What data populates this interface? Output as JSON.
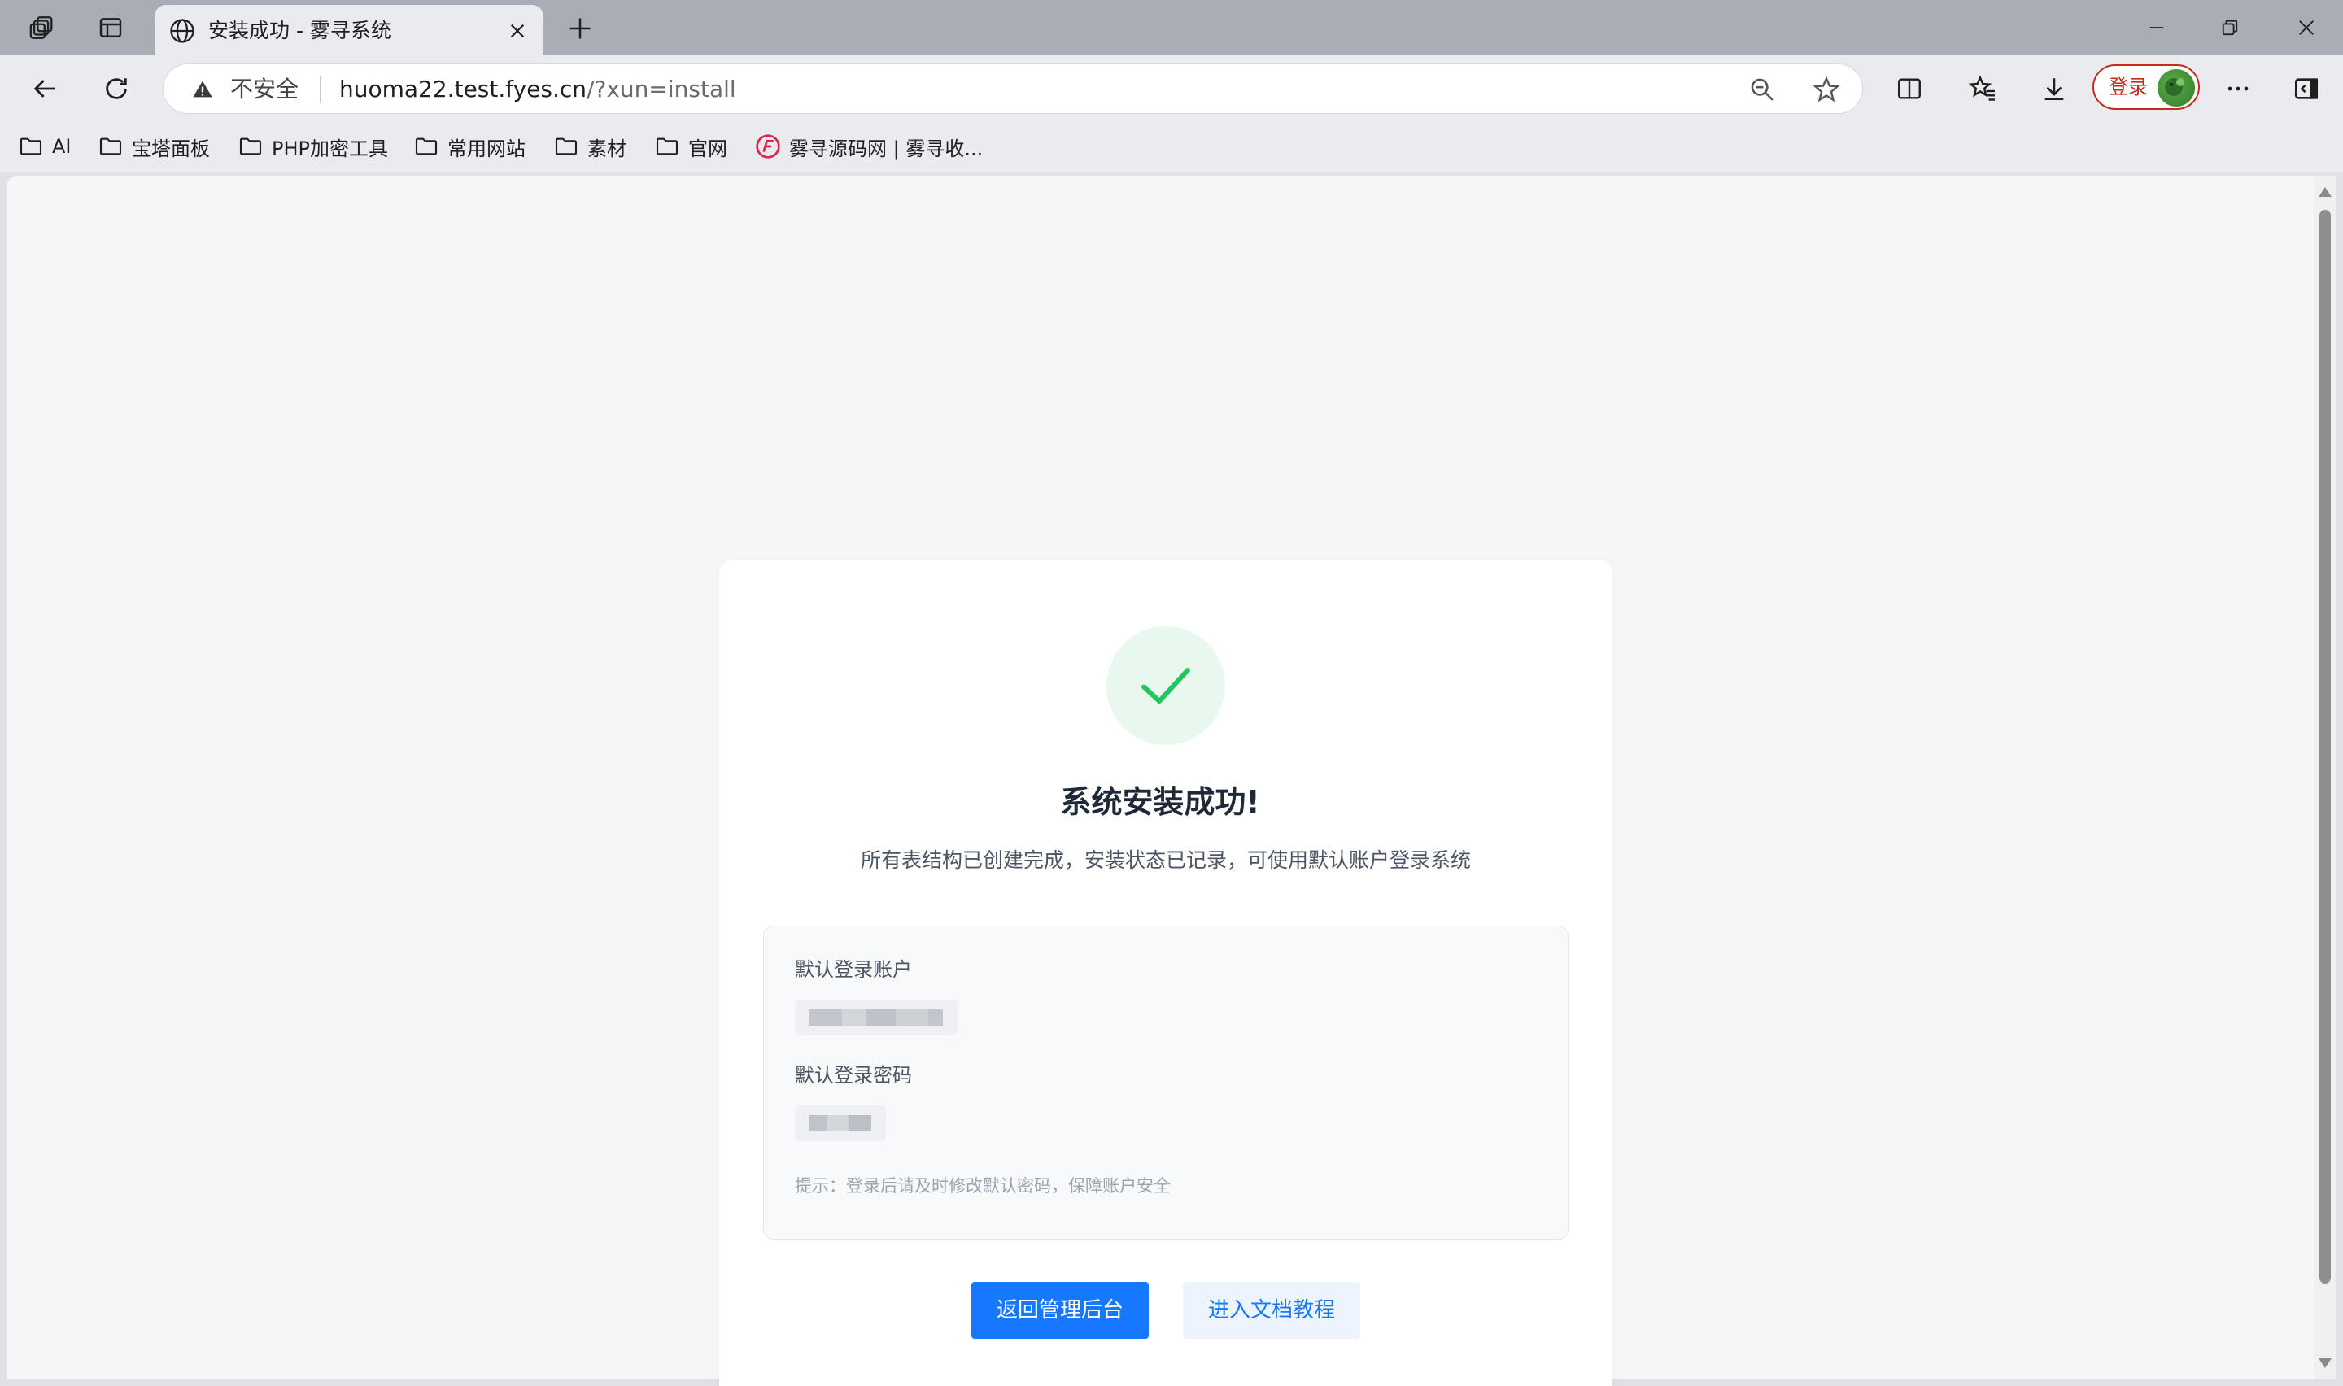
{
  "browser": {
    "tab": {
      "title": "安装成功 - 雾寻系统",
      "icon": "globe-icon"
    },
    "address_bar": {
      "security_label": "不安全",
      "url_host": "huoma22.test.fyes.cn",
      "url_path": "/?xun=install"
    },
    "profile": {
      "login_label": "登录",
      "accent_color": "#c42b1c"
    },
    "bookmarks": [
      {
        "label": "AI",
        "icon": "folder-icon"
      },
      {
        "label": "宝塔面板",
        "icon": "folder-icon"
      },
      {
        "label": "PHP加密工具",
        "icon": "folder-icon"
      },
      {
        "label": "常用网站",
        "icon": "folder-icon"
      },
      {
        "label": "素材",
        "icon": "folder-icon"
      },
      {
        "label": "官网",
        "icon": "folder-icon"
      },
      {
        "label": "雾寻源码网 | 雾寻收...",
        "icon": "site-logo-icon"
      }
    ]
  },
  "page": {
    "heading": "系统安装成功!",
    "subtitle": "所有表结构已创建完成，安装状态已记录，可使用默认账户登录系统",
    "credentials": {
      "account_label": "默认登录账户",
      "password_label": "默认登录密码",
      "tip": "提示：登录后请及时修改默认密码，保障账户安全"
    },
    "buttons": {
      "primary": "返回管理后台",
      "secondary": "进入文档教程"
    },
    "colors": {
      "primary": "#1677ff",
      "success": "#22c55e",
      "success_bg": "#e9f8ef"
    }
  }
}
